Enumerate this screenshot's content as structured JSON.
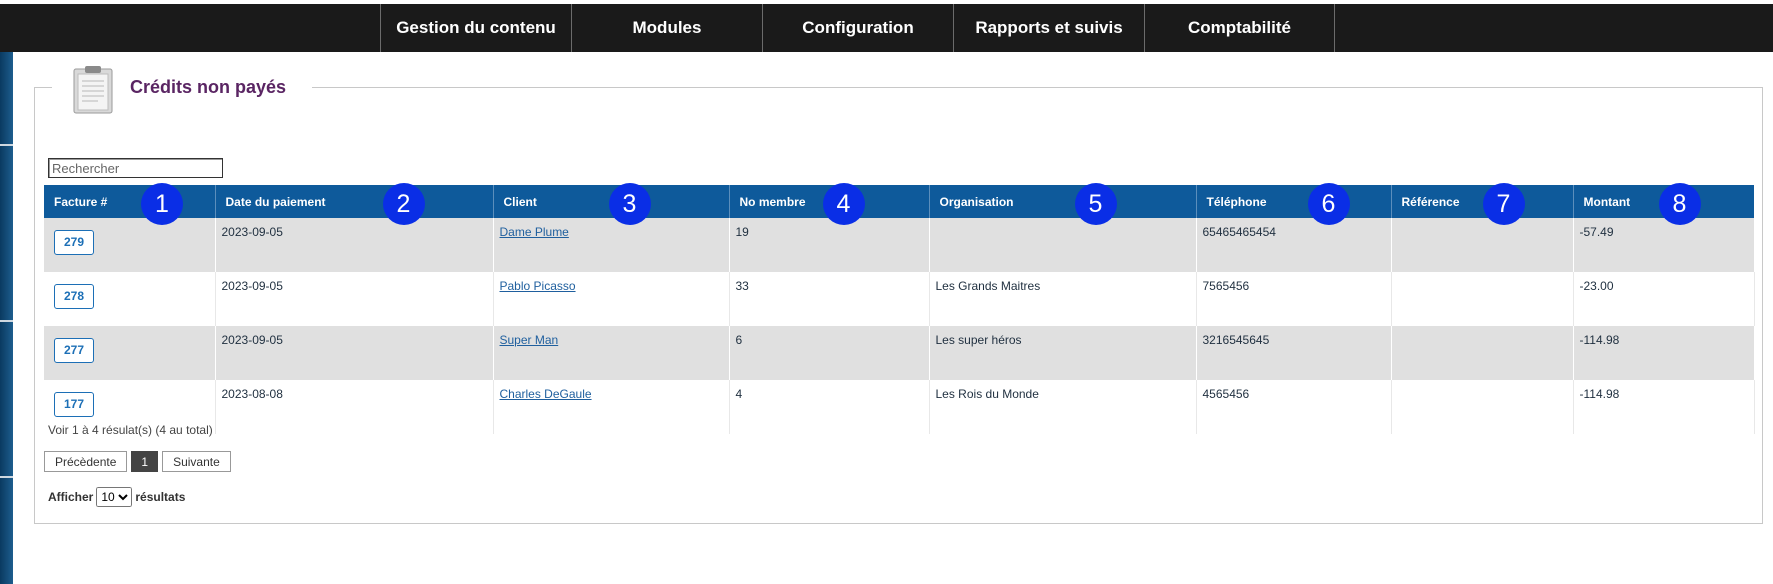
{
  "nav": {
    "items": [
      {
        "label": "Gestion du contenu"
      },
      {
        "label": "Modules"
      },
      {
        "label": "Configuration"
      },
      {
        "label": "Rapports et suivis"
      },
      {
        "label": "Comptabilité"
      }
    ]
  },
  "page": {
    "title": "Crédits non payés"
  },
  "search": {
    "placeholder": "Rechercher",
    "value": ""
  },
  "table": {
    "columns": [
      {
        "label": "Facture #",
        "marker": "1"
      },
      {
        "label": "Date du paiement",
        "marker": "2"
      },
      {
        "label": "Client",
        "marker": "3"
      },
      {
        "label": "No membre",
        "marker": "4"
      },
      {
        "label": "Organisation",
        "marker": "5"
      },
      {
        "label": "Téléphone",
        "marker": "6"
      },
      {
        "label": "Référence",
        "marker": "7"
      },
      {
        "label": "Montant",
        "marker": "8"
      }
    ],
    "rows": [
      {
        "invoice": "279",
        "date": "2023-09-05",
        "client": "Dame Plume",
        "member": "19",
        "org": "",
        "phone": "65465465454",
        "ref": "",
        "amount": "-57.49"
      },
      {
        "invoice": "278",
        "date": "2023-09-05",
        "client": "Pablo Picasso",
        "member": "33",
        "org": "Les Grands Maitres",
        "phone": "7565456",
        "ref": "",
        "amount": "-23.00"
      },
      {
        "invoice": "277",
        "date": "2023-09-05",
        "client": "Super Man",
        "member": "6",
        "org": "Les super héros",
        "phone": "3216545645",
        "ref": "",
        "amount": "-114.98"
      },
      {
        "invoice": "177",
        "date": "2023-08-08",
        "client": "Charles DeGaule",
        "member": "4",
        "org": "Les Rois du Monde",
        "phone": "4565456",
        "ref": "",
        "amount": "-114.98"
      }
    ]
  },
  "footer": {
    "info": "Voir 1 à 4 résulat(s) (4 au total)",
    "prev": "Précèdente",
    "current_page": "1",
    "next": "Suivante",
    "show_label": "Afficher",
    "show_value": "10",
    "results_label": "résultats"
  },
  "colors": {
    "header": "#0e5a9b",
    "title": "#5a2563",
    "negative": "#e00000",
    "marker": "#0a2ee6"
  }
}
